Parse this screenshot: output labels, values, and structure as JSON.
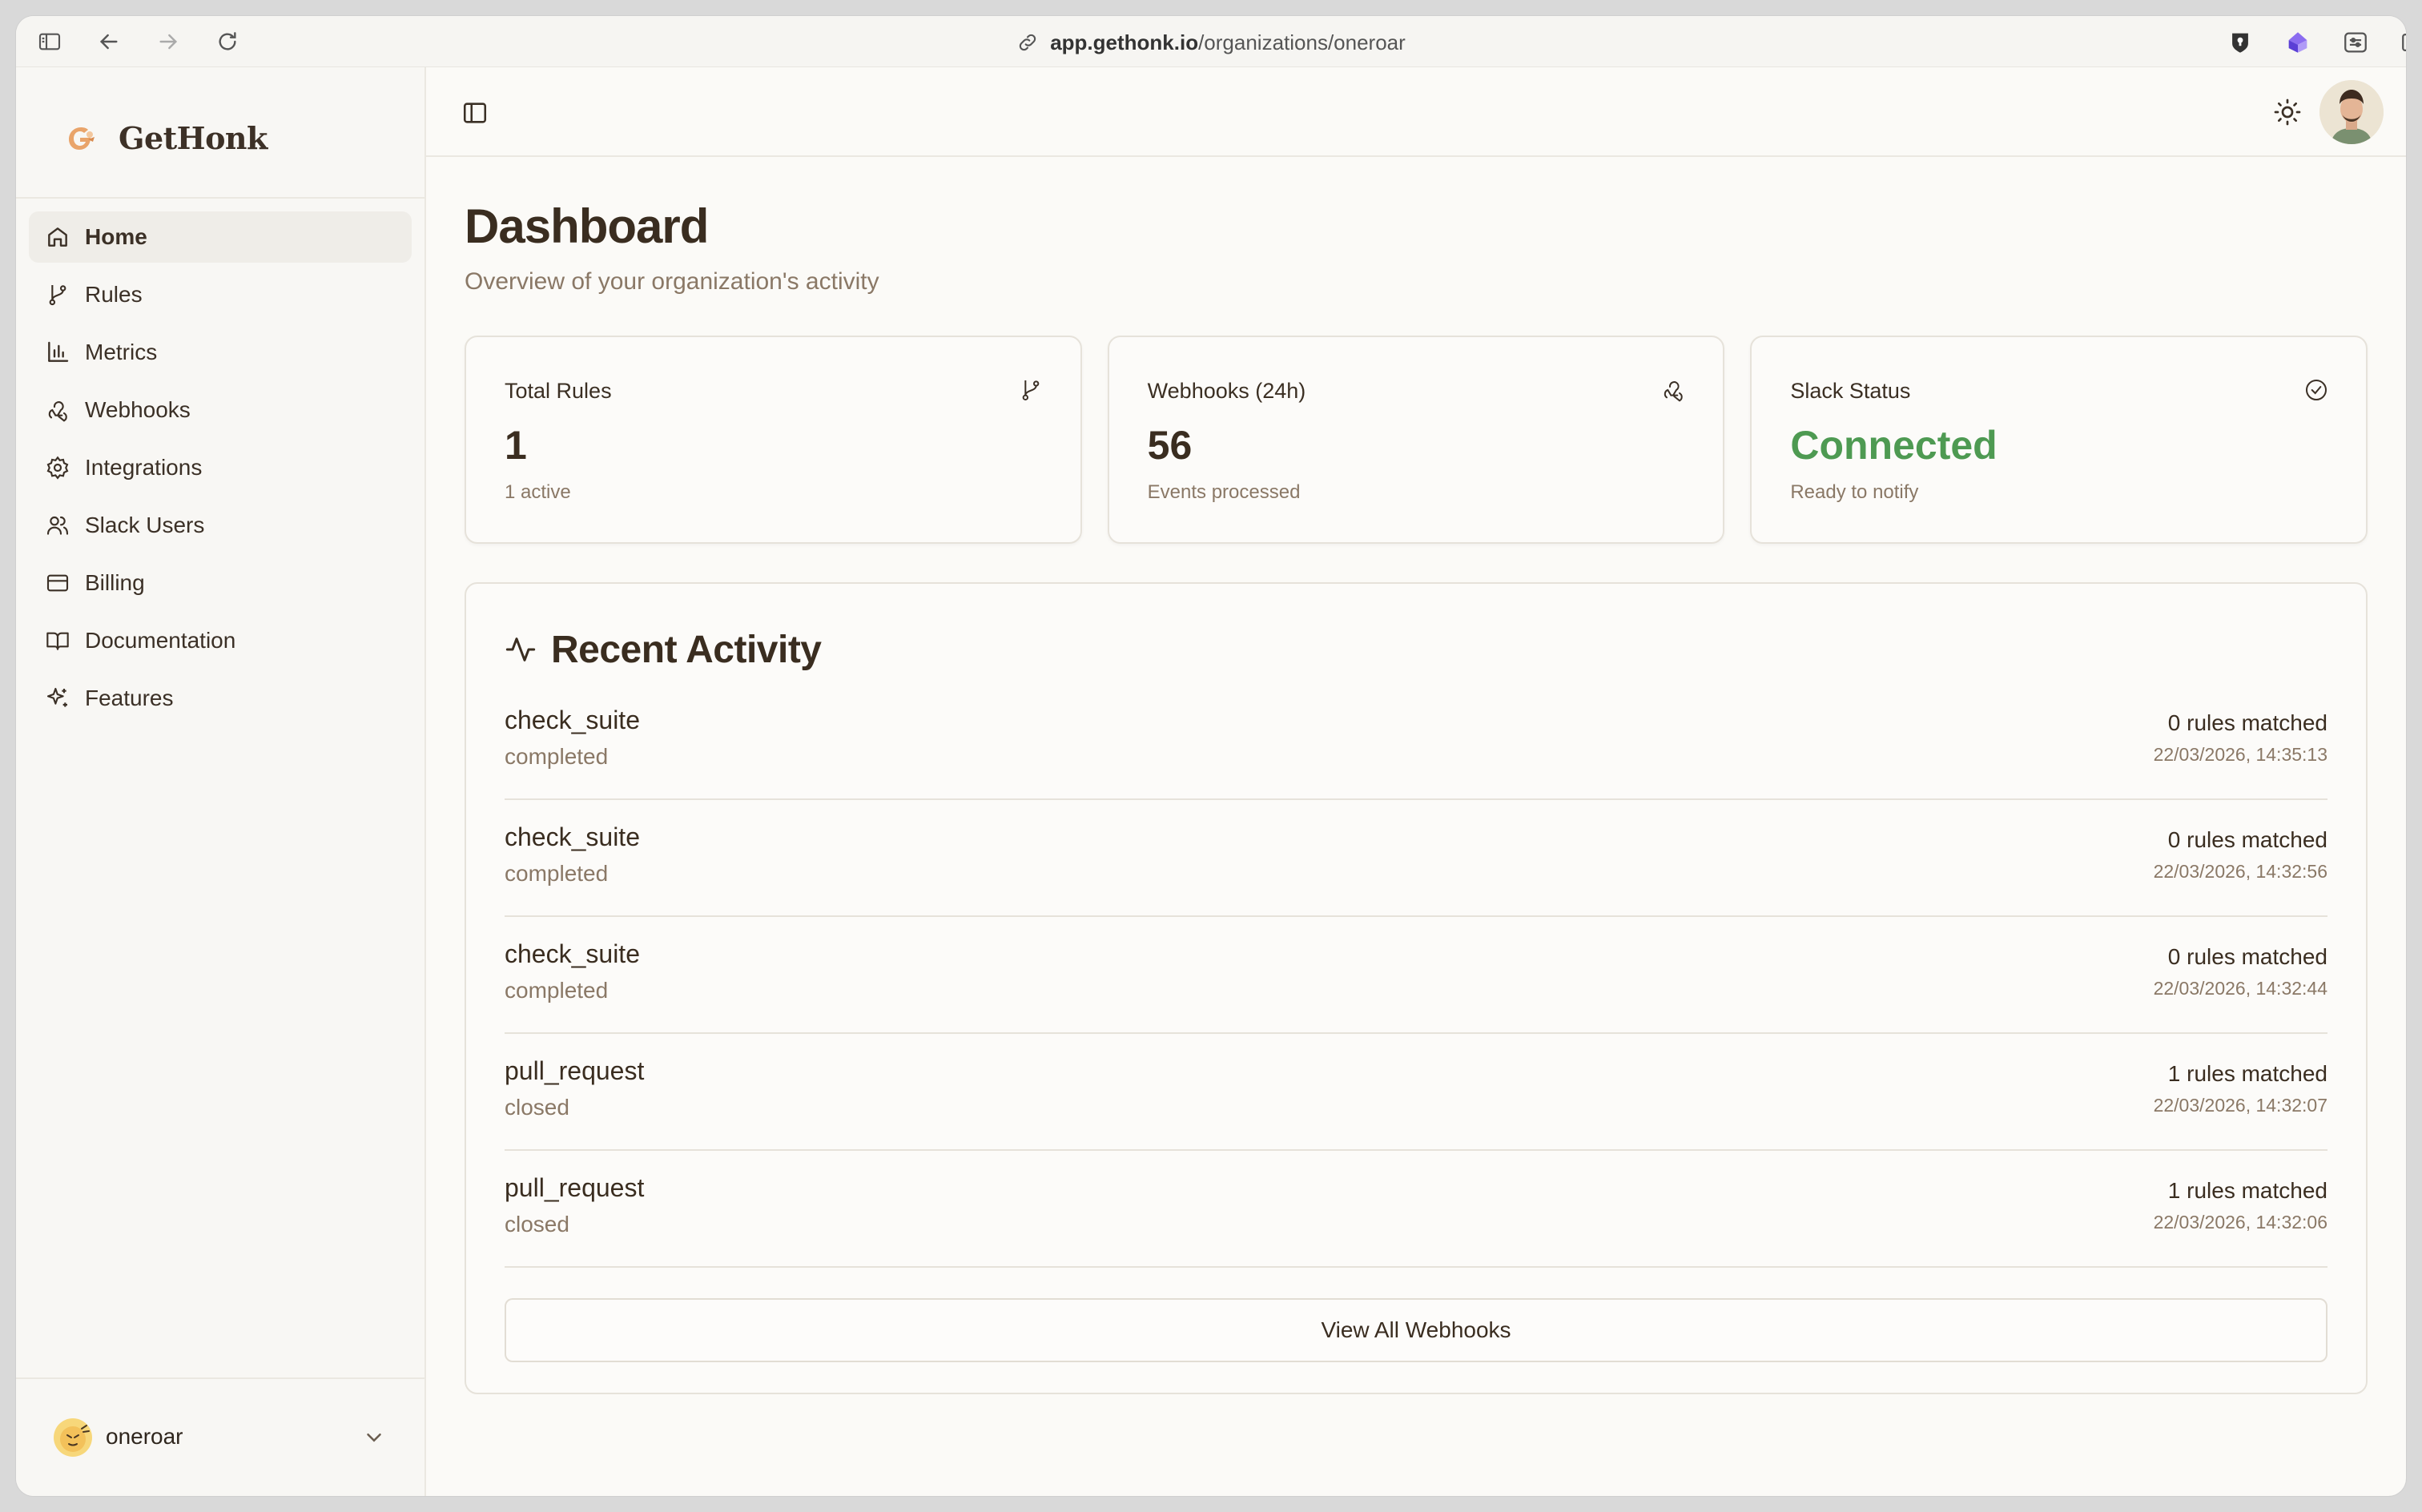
{
  "browser": {
    "url_host": "app.gethonk.io",
    "url_path": "/organizations/oneroar"
  },
  "sidebar": {
    "brand": "GetHonk",
    "items": [
      {
        "label": "Home",
        "icon": "home-icon",
        "active": true
      },
      {
        "label": "Rules",
        "icon": "git-branch-icon"
      },
      {
        "label": "Metrics",
        "icon": "bar-chart-icon"
      },
      {
        "label": "Webhooks",
        "icon": "webhook-icon"
      },
      {
        "label": "Integrations",
        "icon": "gear-icon"
      },
      {
        "label": "Slack Users",
        "icon": "users-icon"
      },
      {
        "label": "Billing",
        "icon": "credit-card-icon"
      },
      {
        "label": "Documentation",
        "icon": "book-icon"
      },
      {
        "label": "Features",
        "icon": "sparkles-icon"
      }
    ],
    "org_name": "oneroar"
  },
  "page": {
    "title": "Dashboard",
    "subtitle": "Overview of your organization's activity"
  },
  "cards": [
    {
      "label": "Total Rules",
      "value": "1",
      "sub": "1 active",
      "icon": "git-branch-icon"
    },
    {
      "label": "Webhooks (24h)",
      "value": "56",
      "sub": "Events processed",
      "icon": "webhook-icon"
    },
    {
      "label": "Slack Status",
      "value": "Connected",
      "sub": "Ready to notify",
      "icon": "check-circle-icon",
      "value_color": "#4e9a52"
    }
  ],
  "activity": {
    "title": "Recent Activity",
    "rows": [
      {
        "event": "check_suite",
        "action": "completed",
        "matched": "0 rules matched",
        "time": "22/03/2026, 14:35:13"
      },
      {
        "event": "check_suite",
        "action": "completed",
        "matched": "0 rules matched",
        "time": "22/03/2026, 14:32:56"
      },
      {
        "event": "check_suite",
        "action": "completed",
        "matched": "0 rules matched",
        "time": "22/03/2026, 14:32:44"
      },
      {
        "event": "pull_request",
        "action": "closed",
        "matched": "1 rules matched",
        "time": "22/03/2026, 14:32:07"
      },
      {
        "event": "pull_request",
        "action": "closed",
        "matched": "1 rules matched",
        "time": "22/03/2026, 14:32:06"
      }
    ],
    "view_all_label": "View All Webhooks"
  }
}
